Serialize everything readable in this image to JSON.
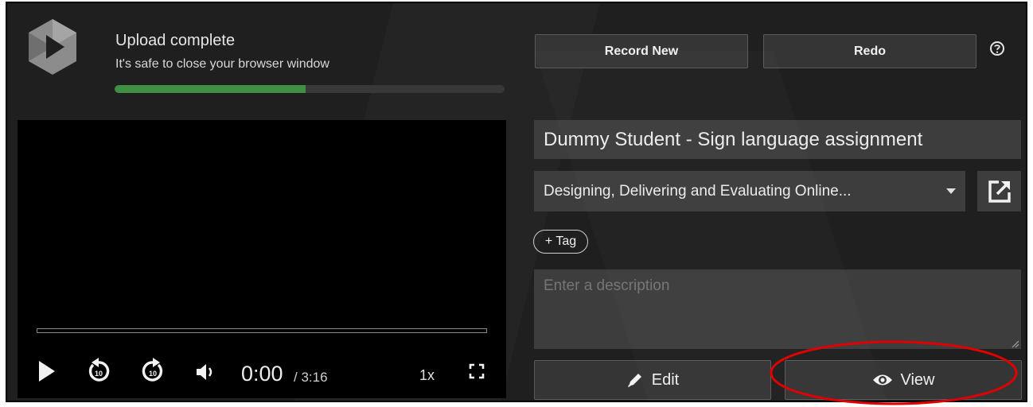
{
  "status": {
    "title": "Upload complete",
    "subtitle": "It's safe to close your browser window",
    "progress_fraction": 0.49,
    "progress_color": "#3f8f44"
  },
  "toolbar": {
    "record_new_label": "Record New",
    "redo_label": "Redo",
    "help_icon": "help-circle-icon"
  },
  "player": {
    "current_time": "0:00",
    "total_time": "/ 3:16",
    "speed": "1x",
    "icons": [
      "play-icon",
      "rewind-10-icon",
      "forward-10-icon",
      "volume-icon",
      "fullscreen-icon"
    ]
  },
  "form": {
    "title_value": "Dummy Student - Sign language assignment",
    "folder_value": "Designing, Delivering and Evaluating Online...",
    "tag_label": "+ Tag",
    "description_placeholder": "Enter a description",
    "description_value": ""
  },
  "actions": {
    "edit_label": "Edit",
    "view_label": "View"
  },
  "colors": {
    "panel_bg": "#1f1f1f",
    "field_bg": "#3d3d3d",
    "highlight": "#e00000"
  }
}
